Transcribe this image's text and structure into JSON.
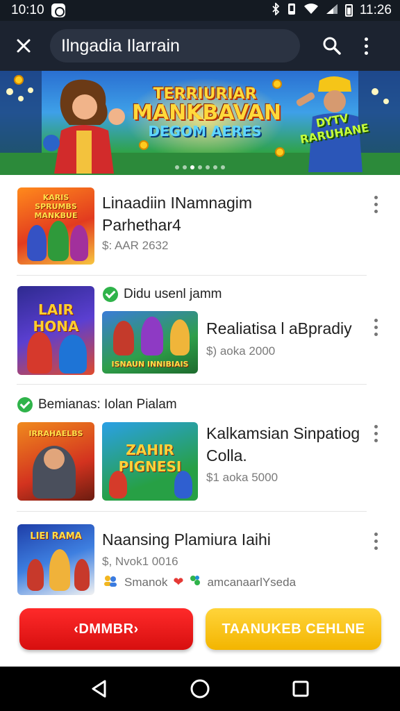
{
  "status_bar": {
    "time_left": "10:10",
    "time_right": "11:26",
    "icons": [
      "app-icon",
      "bluetooth-icon",
      "vibrate-icon",
      "wifi-icon",
      "signal-icon",
      "battery-icon"
    ]
  },
  "app_bar": {
    "title": "Ilngadia Ilarrain",
    "close_icon": "close-icon",
    "search_icon": "search-icon",
    "more_icon": "more-vert-icon"
  },
  "banner": {
    "title_line1": "TERRIURIAR",
    "title_line2": "MANKBAVAN",
    "title_line3": "DEGOM AERES",
    "side_text": "DYTV RARUHANE",
    "dots_count": 7,
    "active_dot": 2
  },
  "list": [
    {
      "title_line1": "Linaadiin INamnagim",
      "title_line2": "Parhethar4",
      "price": "$: AAR 2632",
      "thumb_text": "KARIS SPRUMBS MANKBUE"
    },
    {
      "label": "Didu usenl jamm",
      "left_thumb_text": "LAIR HONA",
      "thumb_text": "ISNAUN INNIBIAIS",
      "title": "Realiatisa l aBpradiy",
      "price": "$) aoka 2000"
    },
    {
      "label": "Bemianas: Iolan Pialam",
      "left_thumb_text": "IRRAHAELBS",
      "thumb_text": "ZAHIR PIGNESI",
      "title_line1": "Kalkamsian Sinpatiog",
      "title_line2": "Colla.",
      "price": "$1 aoka 5000"
    },
    {
      "thumb_text": "LIEI RAMA",
      "title": "Naansing Plamiura Iaihi",
      "price": "$, Nvok1 0016",
      "meta_left": "Smanok",
      "meta_right": "amcanaarlYseda"
    }
  ],
  "buttons": {
    "left": "‹DMMBR›",
    "right": "TAANUKEB CEHLNE"
  },
  "colors": {
    "red_button": "#e01717",
    "yellow_button": "#f7c21a",
    "app_bar": "#1c2330",
    "check_green": "#2fb34a"
  },
  "nav_bar": {
    "icons": [
      "back-icon",
      "home-icon",
      "recents-icon"
    ]
  }
}
